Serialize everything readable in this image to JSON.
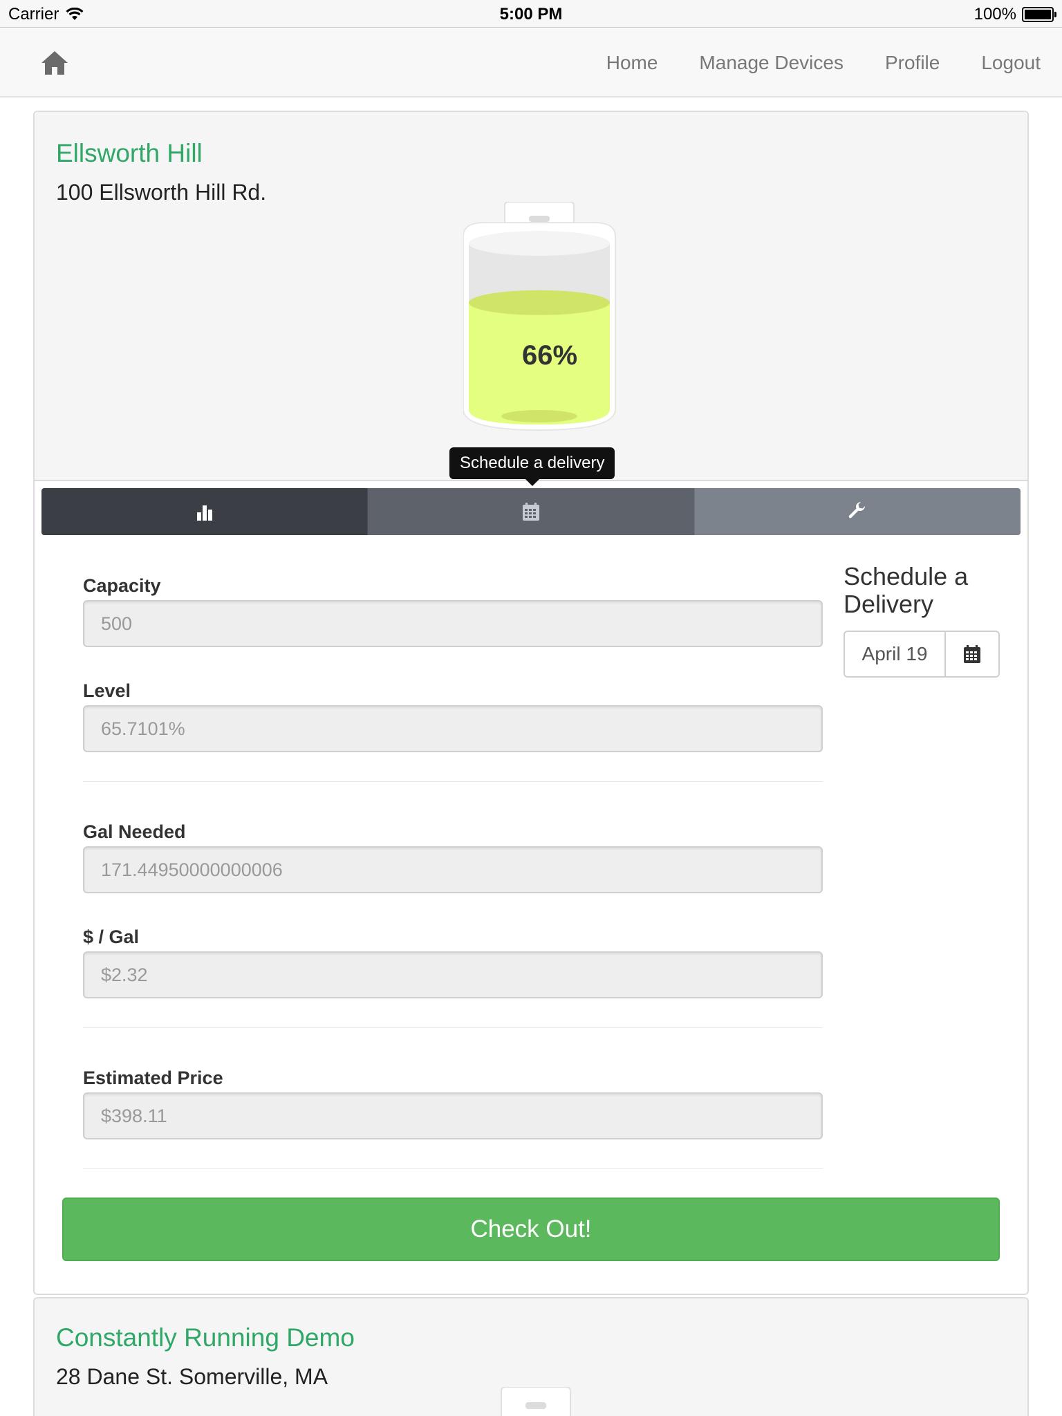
{
  "status_bar": {
    "carrier": "Carrier",
    "time": "5:00 PM",
    "battery": "100%"
  },
  "nav": {
    "links": [
      "Home",
      "Manage Devices",
      "Profile",
      "Logout"
    ]
  },
  "devices": [
    {
      "name": "Ellsworth Hill",
      "address": "100 Ellsworth Hill Rd.",
      "tank_label": "66%",
      "tank_fill_fraction": 0.6571,
      "tooltip": "Schedule a delivery",
      "form": {
        "capacity_label": "Capacity",
        "capacity_value": "500",
        "level_label": "Level",
        "level_value": "65.7101%",
        "gal_needed_label": "Gal Needed",
        "gal_needed_value": "171.44950000000006",
        "price_per_gal_label": "$ / Gal",
        "price_per_gal_value": "$2.32",
        "estimated_price_label": "Estimated Price",
        "estimated_price_value": "$398.11"
      },
      "schedule": {
        "title": "Schedule a Delivery",
        "date": "April 19"
      },
      "checkout_label": "Check Out!"
    },
    {
      "name": "Constantly Running Demo",
      "address": "28 Dane St. Somerville, MA"
    }
  ],
  "colors": {
    "accent_green": "#2fa766",
    "checkout_green": "#5cb85c",
    "tank_fluid": "#e4ff80"
  },
  "icons": {
    "home": "home-icon",
    "stats": "bar-chart-icon",
    "calendar": "calendar-icon",
    "settings": "wrench-icon"
  }
}
